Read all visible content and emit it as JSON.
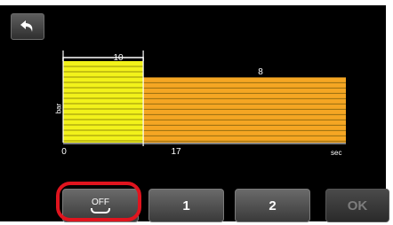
{
  "chart_data": {
    "type": "bar",
    "segments": [
      {
        "start": 0,
        "end": 17,
        "value": 10,
        "label": "10",
        "color": "#f2f21a"
      },
      {
        "start": 17,
        "end": 60,
        "value": 8,
        "label": "8",
        "color": "#f5a623"
      }
    ],
    "x_ticks": [
      "0",
      "17"
    ],
    "x_unit": "sec",
    "y_unit": "bar",
    "ylim": [
      0,
      10
    ]
  },
  "buttons": {
    "off_label": "OFF",
    "one_label": "1",
    "two_label": "2",
    "ok_label": "OK"
  },
  "icons": {
    "back": "back-arrow-icon"
  },
  "colors": {
    "highlight": "#e0141e",
    "background": "#000000"
  }
}
